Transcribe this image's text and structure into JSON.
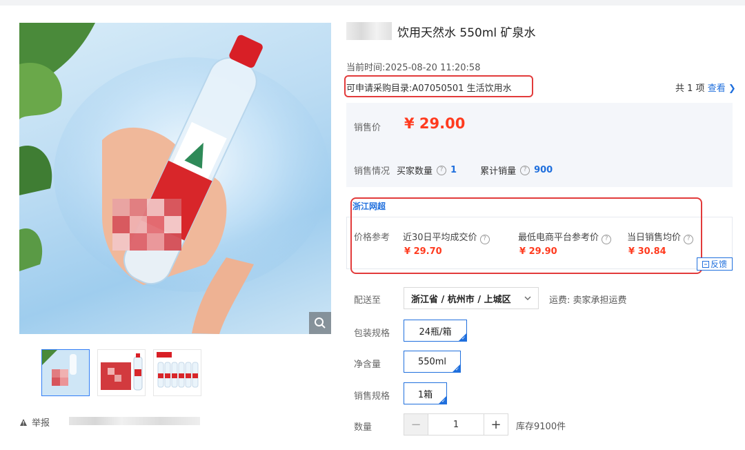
{
  "product": {
    "title": "饮用天然水 550ml 矿泉水",
    "current_time_label": "当前时间:",
    "current_time": "2025-08-20 11:20:58",
    "catalog_label": "可申请采购目录:",
    "catalog_value": "A07050501 生活饮用水",
    "total_prefix": "共 1 项",
    "total_link": "查看",
    "price_label": "销售价",
    "price": "¥ 29.00",
    "sales_label": "销售情况",
    "buyer_count_label": "买家数量",
    "buyer_count": "1",
    "cumulative_label": "累计销量",
    "cumulative": "900"
  },
  "reference": {
    "tab": "浙江网超",
    "label": "价格参考",
    "columns": [
      {
        "title": "近30日平均成交价",
        "value": "¥ 29.70"
      },
      {
        "title": "最低电商平台参考价",
        "value": "¥ 29.90"
      },
      {
        "title": "当日销售均价",
        "value": "¥ 30.84"
      }
    ],
    "feedback": "反馈"
  },
  "delivery": {
    "label": "配送至",
    "region": "浙江省 / 杭州市 / 上城区",
    "freight": "运费: 卖家承担运费"
  },
  "specs": {
    "pack_label": "包装规格",
    "pack_value": "24瓶/箱",
    "net_label": "净含量",
    "net_value": "550ml",
    "sale_label": "销售规格",
    "sale_value": "1箱"
  },
  "quantity": {
    "label": "数量",
    "value": "1",
    "minus": "−",
    "plus": "+",
    "stock": "库存9100件"
  },
  "left": {
    "report": "举报"
  },
  "colors": {
    "accent_blue": "#1f6fdd",
    "price_red": "#ff3b1f",
    "highlight_red": "#e23a3a"
  }
}
